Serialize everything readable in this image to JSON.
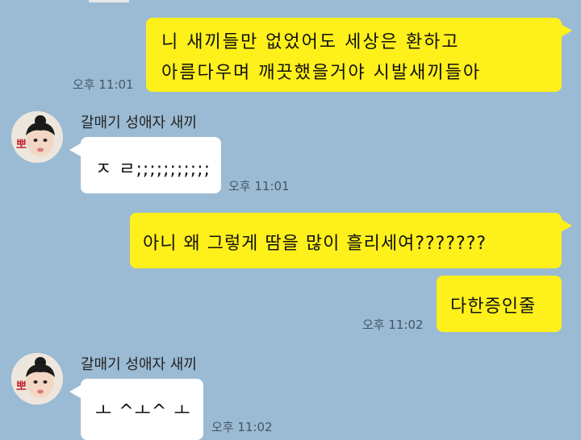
{
  "colors": {
    "background": "#9bbbd4",
    "my_bubble": "#fef01b",
    "their_bubble": "#ffffff",
    "time_text": "#445566"
  },
  "messages": [
    {
      "sender": "me",
      "lines": [
        "니 새끼들만 없었어도 세상은 환하고",
        "아름다우며 깨끗했을거야 시발새끼들아"
      ],
      "time": "오후 11:01"
    },
    {
      "sender": "them",
      "name": "갈매기 성애자 새끼",
      "avatar_icon": "profile-photo-icon",
      "text": "ㅈ ㄹ;;;;;;;;;;;",
      "time": "오후 11:01"
    },
    {
      "sender": "me",
      "text": "아니 왜 그렇게 땀을 많이 흘리세여???????"
    },
    {
      "sender": "me",
      "text": "다한증인줄",
      "time": "오후 11:02"
    },
    {
      "sender": "them",
      "name": "갈매기 성애자 새끼",
      "avatar_icon": "profile-photo-icon",
      "text": "ㅗ ^ㅗ^ ㅗ",
      "time": "오후 11:02"
    }
  ]
}
